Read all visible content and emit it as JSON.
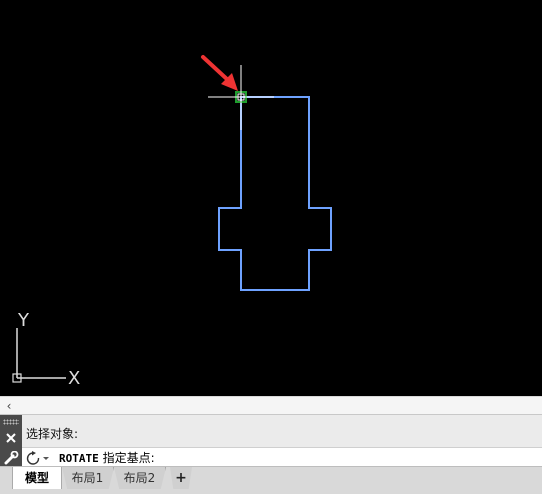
{
  "canvas": {
    "background": "#000000",
    "outline_color": "#6ea2ff",
    "grip_color": "#1f9e2e",
    "arrow_color": "#ee3333",
    "ucs": {
      "y_label": "Y",
      "x_label": "X"
    }
  },
  "scrollbar": {
    "left_arrow": "‹"
  },
  "command_line": {
    "history": "选择对象:",
    "command_name": "ROTATE",
    "prompt": "指定基点:",
    "close_icon": "close-icon",
    "settings_icon": "wrench-icon",
    "recent_icon": "recent-commands-icon"
  },
  "tabs": [
    {
      "label": "模型",
      "active": true
    },
    {
      "label": "布局1",
      "active": false
    },
    {
      "label": "布局2",
      "active": false
    }
  ],
  "add_tab_label": "+"
}
